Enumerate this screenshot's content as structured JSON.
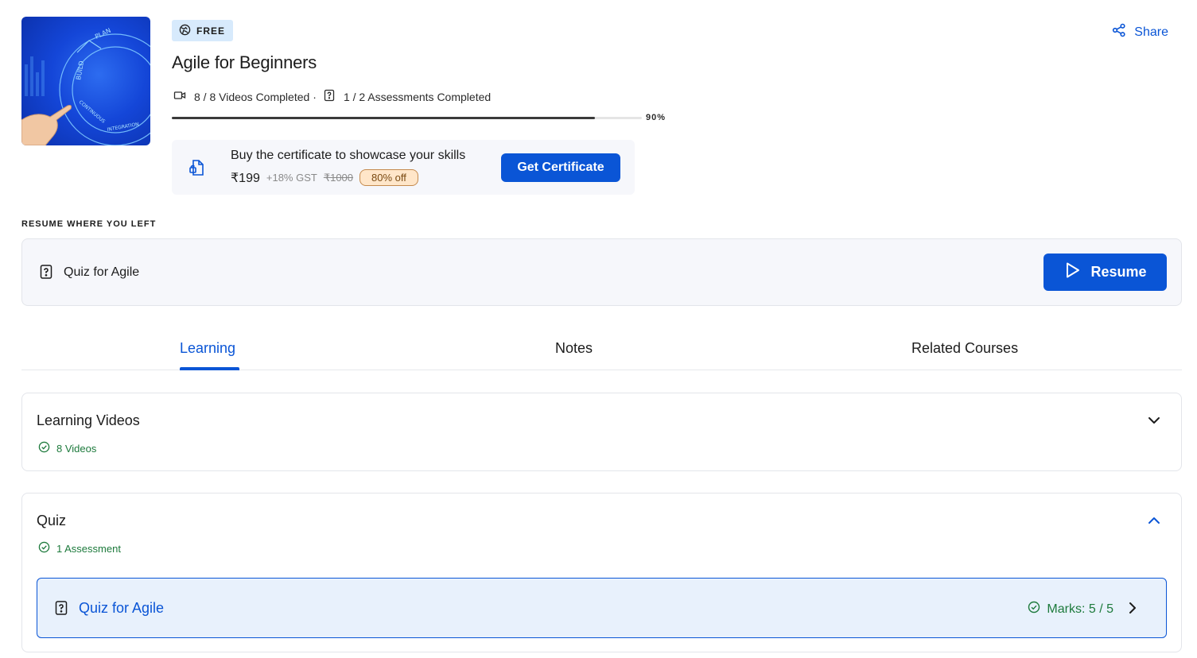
{
  "course": {
    "badge": "FREE",
    "title": "Agile for Beginners",
    "videos_completed": "8 / 8 Videos Completed",
    "separator": "·",
    "assessments_completed": "1 / 2 Assessments Completed",
    "progress_percent": 90,
    "progress_label": "90%",
    "thumbnail_words": [
      "PLAN",
      "BUILD",
      "CONTINUOUS",
      "INTEGRATION"
    ]
  },
  "certificate": {
    "text": "Buy the certificate to showcase your skills",
    "price": "₹199",
    "gst": "+18% GST",
    "original_price": "₹1000",
    "discount": "80% off",
    "button_label": "Get Certificate"
  },
  "share": {
    "label": "Share"
  },
  "resume": {
    "heading": "RESUME WHERE YOU LEFT",
    "item_label": "Quiz for Agile",
    "button_label": "Resume"
  },
  "tabs": [
    {
      "label": "Learning",
      "active": true
    },
    {
      "label": "Notes",
      "active": false
    },
    {
      "label": "Related Courses",
      "active": false
    }
  ],
  "sections": {
    "videos": {
      "title": "Learning Videos",
      "count": "8 Videos",
      "expanded": false
    },
    "quiz": {
      "title": "Quiz",
      "count": "1 Assessment",
      "expanded": true,
      "items": [
        {
          "label": "Quiz for Agile",
          "marks": "Marks: 5 / 5"
        }
      ]
    }
  },
  "colors": {
    "accent": "#0a55d6",
    "success": "#1d7a3c",
    "badge_bg": "#d7eafc",
    "discount_bg": "#ffe6c9"
  },
  "icons": {
    "badge": "globe-icon",
    "video": "video-camera-icon",
    "assessment": "question-file-icon",
    "certificate": "certificate-file-icon",
    "share": "share-icon",
    "resume": "play-icon",
    "done": "check-circle-icon"
  }
}
